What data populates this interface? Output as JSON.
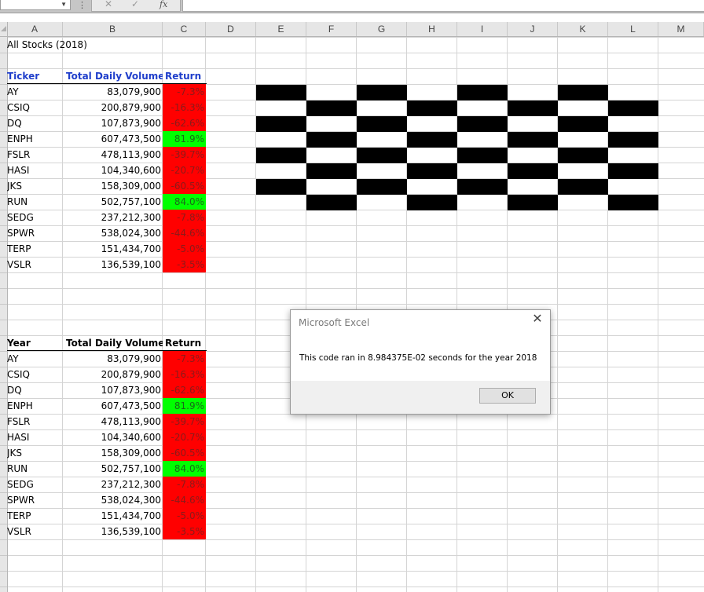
{
  "formula_bar": {
    "cancel_glyph": "✕",
    "enter_glyph": "✓",
    "fx_label": "fx"
  },
  "columns": [
    "A",
    "B",
    "C",
    "D",
    "E",
    "F",
    "G",
    "H",
    "I",
    "J",
    "K",
    "L",
    "M"
  ],
  "sheet": {
    "title": "All Stocks (2018)",
    "table1": {
      "headers": [
        "Ticker",
        "Total Daily Volume",
        "Return"
      ],
      "rows": [
        {
          "ticker": "AY",
          "volume": "83,079,900",
          "ret": "-7.3%",
          "status": "negative"
        },
        {
          "ticker": "CSIQ",
          "volume": "200,879,900",
          "ret": "-16.3%",
          "status": "negative"
        },
        {
          "ticker": "DQ",
          "volume": "107,873,900",
          "ret": "-62.6%",
          "status": "negative"
        },
        {
          "ticker": "ENPH",
          "volume": "607,473,500",
          "ret": "81.9%",
          "status": "positive"
        },
        {
          "ticker": "FSLR",
          "volume": "478,113,900",
          "ret": "-39.7%",
          "status": "negative"
        },
        {
          "ticker": "HASI",
          "volume": "104,340,600",
          "ret": "-20.7%",
          "status": "negative"
        },
        {
          "ticker": "JKS",
          "volume": "158,309,000",
          "ret": "-60.5%",
          "status": "negative"
        },
        {
          "ticker": "RUN",
          "volume": "502,757,100",
          "ret": "84.0%",
          "status": "positive"
        },
        {
          "ticker": "SEDG",
          "volume": "237,212,300",
          "ret": "-7.8%",
          "status": "negative"
        },
        {
          "ticker": "SPWR",
          "volume": "538,024,300",
          "ret": "-44.6%",
          "status": "negative"
        },
        {
          "ticker": "TERP",
          "volume": "151,434,700",
          "ret": "-5.0%",
          "status": "negative"
        },
        {
          "ticker": "VSLR",
          "volume": "136,539,100",
          "ret": "-3.5%",
          "status": "negative"
        }
      ]
    },
    "table2": {
      "headers": [
        "Year",
        "Total Daily Volume",
        "Return"
      ],
      "rows": [
        {
          "ticker": "AY",
          "volume": "83,079,900",
          "ret": "-7.3%",
          "status": "negative"
        },
        {
          "ticker": "CSIQ",
          "volume": "200,879,900",
          "ret": "-16.3%",
          "status": "negative"
        },
        {
          "ticker": "DQ",
          "volume": "107,873,900",
          "ret": "-62.6%",
          "status": "negative"
        },
        {
          "ticker": "ENPH",
          "volume": "607,473,500",
          "ret": "81.9%",
          "status": "positive"
        },
        {
          "ticker": "FSLR",
          "volume": "478,113,900",
          "ret": "-39.7%",
          "status": "negative"
        },
        {
          "ticker": "HASI",
          "volume": "104,340,600",
          "ret": "-20.7%",
          "status": "negative"
        },
        {
          "ticker": "JKS",
          "volume": "158,309,000",
          "ret": "-60.5%",
          "status": "negative"
        },
        {
          "ticker": "RUN",
          "volume": "502,757,100",
          "ret": "84.0%",
          "status": "positive"
        },
        {
          "ticker": "SEDG",
          "volume": "237,212,300",
          "ret": "-7.8%",
          "status": "negative"
        },
        {
          "ticker": "SPWR",
          "volume": "538,024,300",
          "ret": "-44.6%",
          "status": "negative"
        },
        {
          "ticker": "TERP",
          "volume": "151,434,700",
          "ret": "-5.0%",
          "status": "negative"
        },
        {
          "ticker": "VSLR",
          "volume": "136,539,100",
          "ret": "-3.5%",
          "status": "negative"
        }
      ]
    }
  },
  "colors": {
    "negative_fill": "#ff0000",
    "positive_fill": "#00ff00",
    "header_text": "#1f3ecb"
  },
  "dialog": {
    "title": "Microsoft Excel",
    "message": "This code ran in 8.984375E-02 seconds for the year 2018",
    "ok_label": "OK",
    "close_icon": "close-icon"
  }
}
